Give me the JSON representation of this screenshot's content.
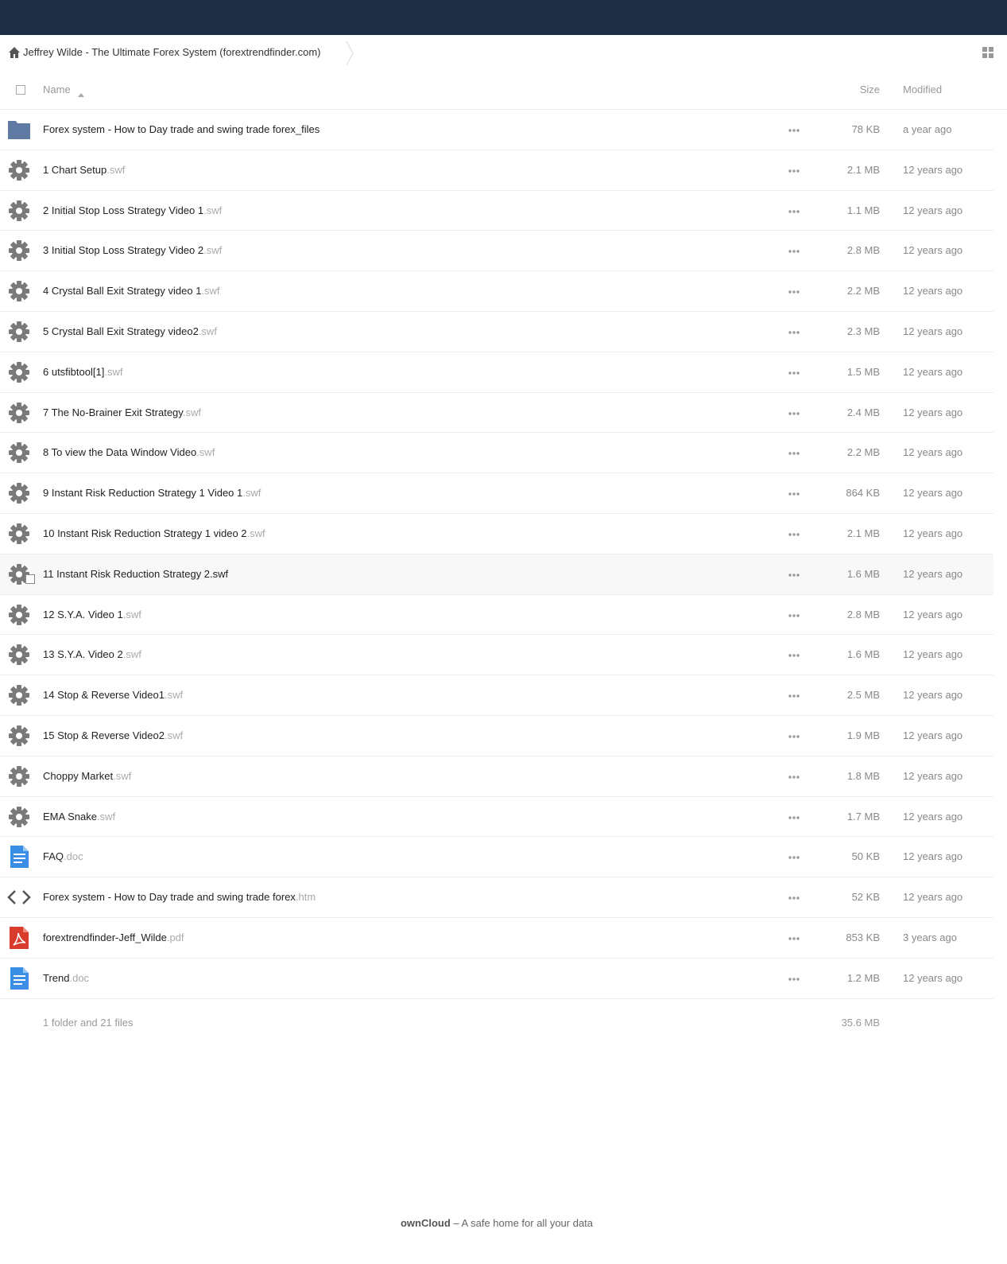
{
  "breadcrumb": {
    "home_icon": "home-icon",
    "title": "Jeffrey Wilde - The Ultimate Forex System (forextrendfinder.com)"
  },
  "header": {
    "name_label": "Name",
    "size_label": "Size",
    "modified_label": "Modified"
  },
  "files": [
    {
      "icon": "folder-icon",
      "name": "Forex system - How to Day trade and swing trade forex_files",
      "ext": "",
      "size": "78 KB",
      "modified": "a year ago"
    },
    {
      "icon": "gear-icon",
      "name": "1 Chart Setup",
      "ext": ".swf",
      "size": "2.1 MB",
      "modified": "12 years ago"
    },
    {
      "icon": "gear-icon",
      "name": "2 Initial Stop Loss Strategy Video 1",
      "ext": ".swf",
      "size": "1.1 MB",
      "modified": "12 years ago"
    },
    {
      "icon": "gear-icon",
      "name": "3 Initial Stop Loss Strategy Video 2",
      "ext": ".swf",
      "size": "2.8 MB",
      "modified": "12 years ago"
    },
    {
      "icon": "gear-icon",
      "name": "4 Crystal Ball Exit Strategy video 1",
      "ext": ".swf",
      "size": "2.2 MB",
      "modified": "12 years ago"
    },
    {
      "icon": "gear-icon",
      "name": "5 Crystal Ball Exit Strategy video2",
      "ext": ".swf",
      "size": "2.3 MB",
      "modified": "12 years ago"
    },
    {
      "icon": "gear-icon",
      "name": "6 utsfibtool[1]",
      "ext": ".swf",
      "size": "1.5 MB",
      "modified": "12 years ago"
    },
    {
      "icon": "gear-icon",
      "name": "7 The No-Brainer Exit Strategy",
      "ext": ".swf",
      "size": "2.4 MB",
      "modified": "12 years ago"
    },
    {
      "icon": "gear-icon",
      "name": "8 To view the Data Window Video",
      "ext": ".swf",
      "size": "2.2 MB",
      "modified": "12 years ago"
    },
    {
      "icon": "gear-icon",
      "name": "9 Instant Risk Reduction Strategy 1 Video 1",
      "ext": ".swf",
      "size": "864 KB",
      "modified": "12 years ago"
    },
    {
      "icon": "gear-icon",
      "name": "10 Instant Risk Reduction Strategy 1 video 2",
      "ext": ".swf",
      "size": "2.1 MB",
      "modified": "12 years ago"
    },
    {
      "icon": "gear-icon",
      "name": "11 Instant Risk Reduction Strategy 2",
      "ext": ".swf",
      "size": "1.6 MB",
      "modified": "12 years ago"
    },
    {
      "icon": "gear-icon",
      "name": "12 S.Y.A. Video 1",
      "ext": ".swf",
      "size": "2.8 MB",
      "modified": "12 years ago"
    },
    {
      "icon": "gear-icon",
      "name": "13 S.Y.A. Video 2",
      "ext": ".swf",
      "size": "1.6 MB",
      "modified": "12 years ago"
    },
    {
      "icon": "gear-icon",
      "name": "14 Stop & Reverse Video1",
      "ext": ".swf",
      "size": "2.5 MB",
      "modified": "12 years ago"
    },
    {
      "icon": "gear-icon",
      "name": "15 Stop & Reverse Video2",
      "ext": ".swf",
      "size": "1.9 MB",
      "modified": "12 years ago"
    },
    {
      "icon": "gear-icon",
      "name": "Choppy Market",
      "ext": ".swf",
      "size": "1.8 MB",
      "modified": "12 years ago"
    },
    {
      "icon": "gear-icon",
      "name": "EMA Snake",
      "ext": ".swf",
      "size": "1.7 MB",
      "modified": "12 years ago"
    },
    {
      "icon": "document-icon",
      "name": "FAQ",
      "ext": ".doc",
      "size": "50 KB",
      "modified": "12 years ago"
    },
    {
      "icon": "code-icon",
      "name": "Forex system - How to Day trade and swing trade forex",
      "ext": ".htm",
      "size": "52 KB",
      "modified": "12 years ago"
    },
    {
      "icon": "pdf-icon",
      "name": "forextrendfinder-Jeff_Wilde",
      "ext": ".pdf",
      "size": "853 KB",
      "modified": "3 years ago"
    },
    {
      "icon": "document-icon",
      "name": "Trend",
      "ext": ".doc",
      "size": "1.2 MB",
      "modified": "12 years ago"
    }
  ],
  "hovered_row": 11,
  "summary": {
    "text": "1 folder and 21 files",
    "size": "35.6 MB"
  },
  "footer": {
    "brand": "ownCloud",
    "tagline": " – A safe home for all your data"
  },
  "colors": {
    "topbar": "#1d2d44",
    "folder": "#5f7ba3",
    "gear": "#7a7a7a",
    "document": "#3a8ee6",
    "pdf": "#d93b2c"
  }
}
